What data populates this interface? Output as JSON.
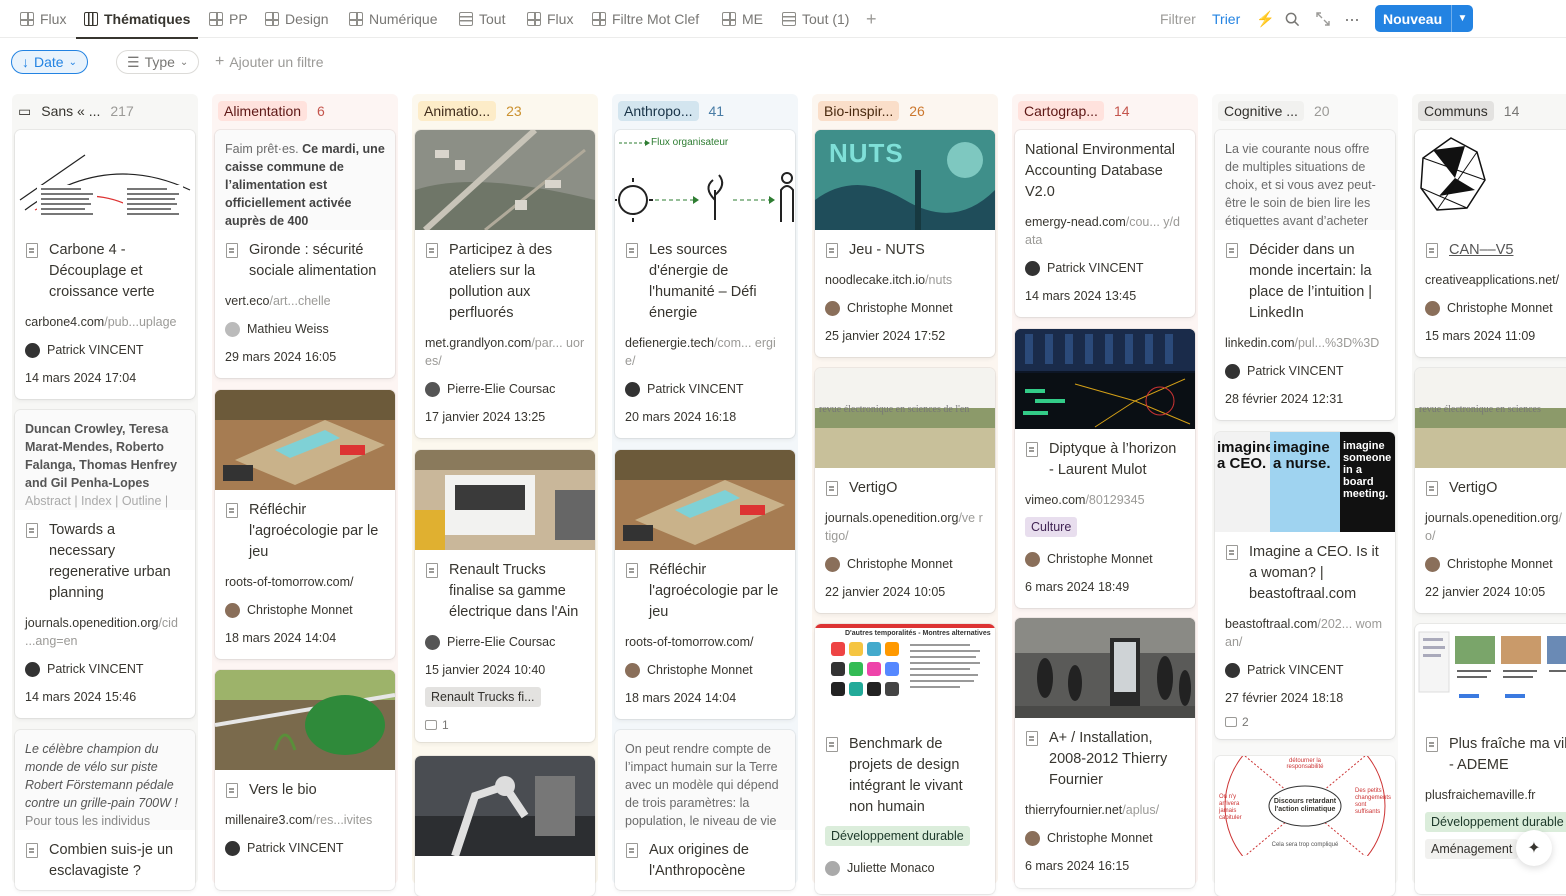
{
  "views": [
    {
      "label": "Flux",
      "icon": "grid"
    },
    {
      "label": "Thématiques",
      "icon": "board"
    },
    {
      "label": "PP",
      "icon": "grid"
    },
    {
      "label": "Design",
      "icon": "grid"
    },
    {
      "label": "Numérique",
      "icon": "grid"
    },
    {
      "label": "Tout",
      "icon": "table"
    },
    {
      "label": "Flux",
      "icon": "grid"
    },
    {
      "label": "Filtre Mot Clef",
      "icon": "grid"
    },
    {
      "label": "ME",
      "icon": "grid"
    },
    {
      "label": "Tout (1)",
      "icon": "table"
    }
  ],
  "toolbar": {
    "filter": "Filtrer",
    "sort": "Trier",
    "new_button": "Nouveau",
    "accent": "#2383e2"
  },
  "filters": {
    "date": "Date",
    "type": "Type",
    "add": "Ajouter un filtre"
  },
  "columns": [
    {
      "name": "Sans « ...",
      "count": "217",
      "tag_bg": "transparent",
      "tag_fg": "#37352f",
      "col_bg": "#f7f7f5",
      "cnt_fg": "#9b9a97"
    },
    {
      "name": "Alimentation",
      "count": "6",
      "tag_bg": "#ffe2dd",
      "tag_fg": "#5d1715",
      "col_bg": "#fdf5f3",
      "cnt_fg": "#c4554d"
    },
    {
      "name": "Animatio...",
      "count": "23",
      "tag_bg": "#fdecc8",
      "tag_fg": "#402c1b",
      "col_bg": "#fcf8ee",
      "cnt_fg": "#cb912f"
    },
    {
      "name": "Anthropo...",
      "count": "41",
      "tag_bg": "#d3e5ef",
      "tag_fg": "#183347",
      "col_bg": "#f3f7fa",
      "cnt_fg": "#487ca5"
    },
    {
      "name": "Bio-inspir...",
      "count": "26",
      "tag_bg": "#fadec9",
      "tag_fg": "#49290e",
      "col_bg": "#fcf6f0",
      "cnt_fg": "#cc782f"
    },
    {
      "name": "Cartograp...",
      "count": "14",
      "tag_bg": "#ffe2dd",
      "tag_fg": "#5d1715",
      "col_bg": "#fdf5f3",
      "cnt_fg": "#c4554d"
    },
    {
      "name": "Cognitive ...",
      "count": "20",
      "tag_bg": "#f1f1ef",
      "tag_fg": "#32302c",
      "col_bg": "#f9f9f8",
      "cnt_fg": "#9b9a97"
    },
    {
      "name": "Communs",
      "count": "14",
      "tag_bg": "#e3e2e0",
      "tag_fg": "#32302c",
      "col_bg": "#f7f7f5",
      "cnt_fg": "#787774"
    }
  ],
  "cards": {
    "c0a": {
      "title": "Carbone 4 - Découplage et croissance verte",
      "url_a": "carbone4.com",
      "url_b": "/pub...uplage",
      "person": "Patrick VINCENT",
      "date": "14 mars 2024 17:04"
    },
    "c0b": {
      "preview": "Duncan Crowley, Teresa Marat-Mendes, Roberto Falanga, Thomas Henfrey and Gil Penha-Lopes",
      "preview2": "Abstract | Index | Outline |",
      "title": "Towards a necessary regenerative urban planning",
      "url_a": "journals.openedition.org",
      "url_b": "/cid ...ang=en",
      "person": "Patrick VINCENT",
      "date": "14 mars 2024 15:46"
    },
    "c0c": {
      "preview": "Le célèbre champion du monde de vélo sur piste Robert Förstemann pédale contre un grille-pain 700W !",
      "preview2": "Pour tous les individus",
      "title": "Combien suis-je un esclavagiste ?"
    },
    "c1a": {
      "preview_a": "Faim prêt·es. ",
      "preview_b": "Ce mardi, une caisse commune de l’alimentation est officiellement activée auprès de 400",
      "title": "Gironde : sécurité sociale alimentation",
      "url_a": "vert.eco",
      "url_b": "/art...chelle",
      "person": "Mathieu Weiss",
      "date": "29 mars 2024 16:05"
    },
    "c1b": {
      "title": "Réfléchir l'agroécologie par le jeu",
      "url_a": "roots-of-tomorrow.com/",
      "url_b": "",
      "person": "Christophe Monnet",
      "date": "18 mars 2024 14:04"
    },
    "c1c": {
      "title": "Vers le bio",
      "url_a": "millenaire3.com",
      "url_b": "/res...ivites",
      "person": "Patrick VINCENT"
    },
    "c2a": {
      "title": "Participez à des ateliers sur la pollution aux perfluorés",
      "url_a": "met.grandlyon.com",
      "url_b": "/par... uores/",
      "person": "Pierre-Elie Coursac",
      "date": "17 janvier 2024 13:25"
    },
    "c2b": {
      "title": "Renault Trucks finalise sa gamme électrique dans l'Ain",
      "url_a": "",
      "url_b": "",
      "person": "Pierre-Elie Coursac",
      "date": "15 janvier 2024 10:40",
      "tag": "Renault Trucks fi...",
      "comments": "1"
    },
    "c3a": {
      "cover_label": "Flux organisateur",
      "title": "Les sources d'énergie de l'humanité – Défi énergie",
      "url_a": "defienergie.tech",
      "url_b": "/com... ergie/",
      "person": "Patrick VINCENT",
      "date": "20 mars 2024 16:18"
    },
    "c3b": {
      "title": "Réfléchir l'agroécologie par le jeu",
      "url_a": "roots-of-tomorrow.com/",
      "url_b": "",
      "person": "Christophe Monnet",
      "date": "18 mars 2024 14:04"
    },
    "c3c": {
      "preview": "On peut rendre compte de l’impact humain sur la Terre avec un modèle qui dépend de trois paramètres: la population, le niveau de vie",
      "title": "Aux origines de l'Anthropocène"
    },
    "c4a": {
      "cover_label": "NUTS",
      "title": "Jeu - NUTS",
      "url_a": "noodlecake.itch.io",
      "url_b": "/nuts",
      "person": "Christophe Monnet",
      "date": "25 janvier 2024 17:52"
    },
    "c4b": {
      "cover_label": "revue électronique en sciences de l'en",
      "title": "VertigO",
      "url_a": "journals.openedition.org",
      "url_b": "/ve rtigo/",
      "person": "Christophe Monnet",
      "date": "22 janvier 2024 10:05"
    },
    "c4c": {
      "cover_label": "D'autres temporalités - Montres alternatives",
      "title": "Benchmark de projets de design intégrant le vivant non humain",
      "tag": "Développement durable",
      "person": "Juliette Monaco"
    },
    "c5a": {
      "title": "National Environmental Accounting Database V2.0",
      "url_a": "emergy-nead.com",
      "url_b": "/cou... y/data",
      "person": "Patrick VINCENT",
      "date": "14 mars 2024 13:45"
    },
    "c5b": {
      "title": "Diptyque à l’horizon - Laurent Mulot",
      "url_a": "vimeo.com",
      "url_b": "/80129345",
      "tag": "Culture",
      "person": "Christophe Monnet",
      "date": "6 mars 2024 18:49"
    },
    "c5c": {
      "title": "A+ / Installation, 2008-2012 Thierry Fournier",
      "url_a": "thierryfournier.net",
      "url_b": "/aplus/",
      "person": "Christophe Monnet",
      "date": "6 mars 2024 16:15"
    },
    "c6a": {
      "preview": "La vie courante nous offre de multiples situations de choix, et si vous avez peut-être le soin de bien lire les étiquettes avant d’acheter",
      "title": "Décider dans un monde incertain: la place de l’intuition | LinkedIn",
      "url_a": "linkedin.com",
      "url_b": "/pul...%3D%3D",
      "person": "Patrick VINCENT",
      "date": "28 février 2024 12:31"
    },
    "c6b": {
      "cover_a": "imagine a CEO.",
      "cover_b": "imagine a nurse.",
      "cover_c": "imagine someone in a board meeting.",
      "title": "Imagine a CEO. Is it a woman? | beastoftraal.com",
      "url_a": "beastoftraal.com",
      "url_b": "/202... woman/",
      "person": "Patrick VINCENT",
      "date": "27 février 2024 18:18",
      "comments": "2"
    },
    "c6c": {
      "cover_center": "Discours retardant l'action climatique",
      "cover_top": "détourner la responsabilité",
      "cover_left": "On n'y arrivera jamais capituler",
      "cover_right": "Des petits changements sont suffisants",
      "cover_bottom": "Cela sera trop compliqué"
    },
    "c7a": {
      "title": "CAN––V5",
      "url_a": "creativeapplications.net/",
      "url_b": "",
      "person": "Christophe Monnet",
      "date": "15 mars 2024 11:09"
    },
    "c7b": {
      "cover_label": "revue électronique en sciences",
      "title": "VertigO",
      "url_a": "journals.openedition.org",
      "url_b": "/ rtigo/",
      "person": "Christophe Monnet",
      "date": "22 janvier 2024 10:05"
    },
    "c7c": {
      "title": "Plus fraîche ma ville - ADEME",
      "url_a": "plusfraichemaville.fr",
      "url_b": "",
      "tag": "Développement durable",
      "tag2": "Aménagement"
    }
  }
}
